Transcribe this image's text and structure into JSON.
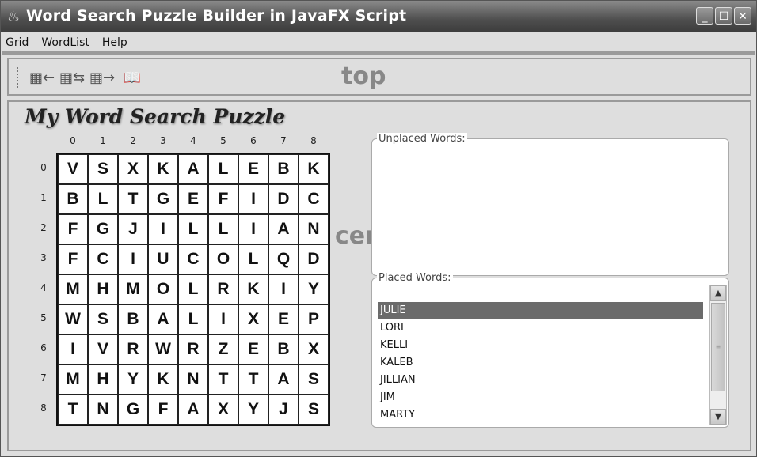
{
  "window": {
    "title": "Word Search Puzzle Builder in JavaFX Script",
    "icon": "java-cup-icon",
    "controls": {
      "minimize": "_",
      "maximize": "☐",
      "close": "✕"
    }
  },
  "menu": [
    "Grid",
    "WordList",
    "Help"
  ],
  "toolbar": {
    "icons": [
      "grid-left-icon",
      "grid-swap-icon",
      "grid-right-icon",
      "book-add-icon"
    ],
    "region_label": "top"
  },
  "center": {
    "region_label": "center",
    "puzzle_title": "My Word Search Puzzle",
    "columns": [
      "0",
      "1",
      "2",
      "3",
      "4",
      "5",
      "6",
      "7",
      "8"
    ],
    "rows": [
      "0",
      "1",
      "2",
      "3",
      "4",
      "5",
      "6",
      "7",
      "8"
    ],
    "grid": [
      [
        "V",
        "S",
        "X",
        "K",
        "A",
        "L",
        "E",
        "B",
        "K"
      ],
      [
        "B",
        "L",
        "T",
        "G",
        "E",
        "F",
        "I",
        "D",
        "C"
      ],
      [
        "F",
        "G",
        "J",
        "I",
        "L",
        "L",
        "I",
        "A",
        "N"
      ],
      [
        "F",
        "C",
        "I",
        "U",
        "C",
        "O",
        "L",
        "Q",
        "D"
      ],
      [
        "M",
        "H",
        "M",
        "O",
        "L",
        "R",
        "K",
        "I",
        "Y"
      ],
      [
        "W",
        "S",
        "B",
        "A",
        "L",
        "I",
        "X",
        "E",
        "P"
      ],
      [
        "I",
        "V",
        "R",
        "W",
        "R",
        "Z",
        "E",
        "B",
        "X"
      ],
      [
        "M",
        "H",
        "Y",
        "K",
        "N",
        "T",
        "T",
        "A",
        "S"
      ],
      [
        "T",
        "N",
        "G",
        "F",
        "A",
        "X",
        "Y",
        "J",
        "S"
      ]
    ],
    "unplaced_label": "Unplaced Words:",
    "placed_label": "Placed Words:",
    "placed_words": [
      "JULIE",
      "LORI",
      "KELLI",
      "KALEB",
      "JILLIAN",
      "JIM",
      "MARTY"
    ],
    "selected_word": "JULIE"
  }
}
